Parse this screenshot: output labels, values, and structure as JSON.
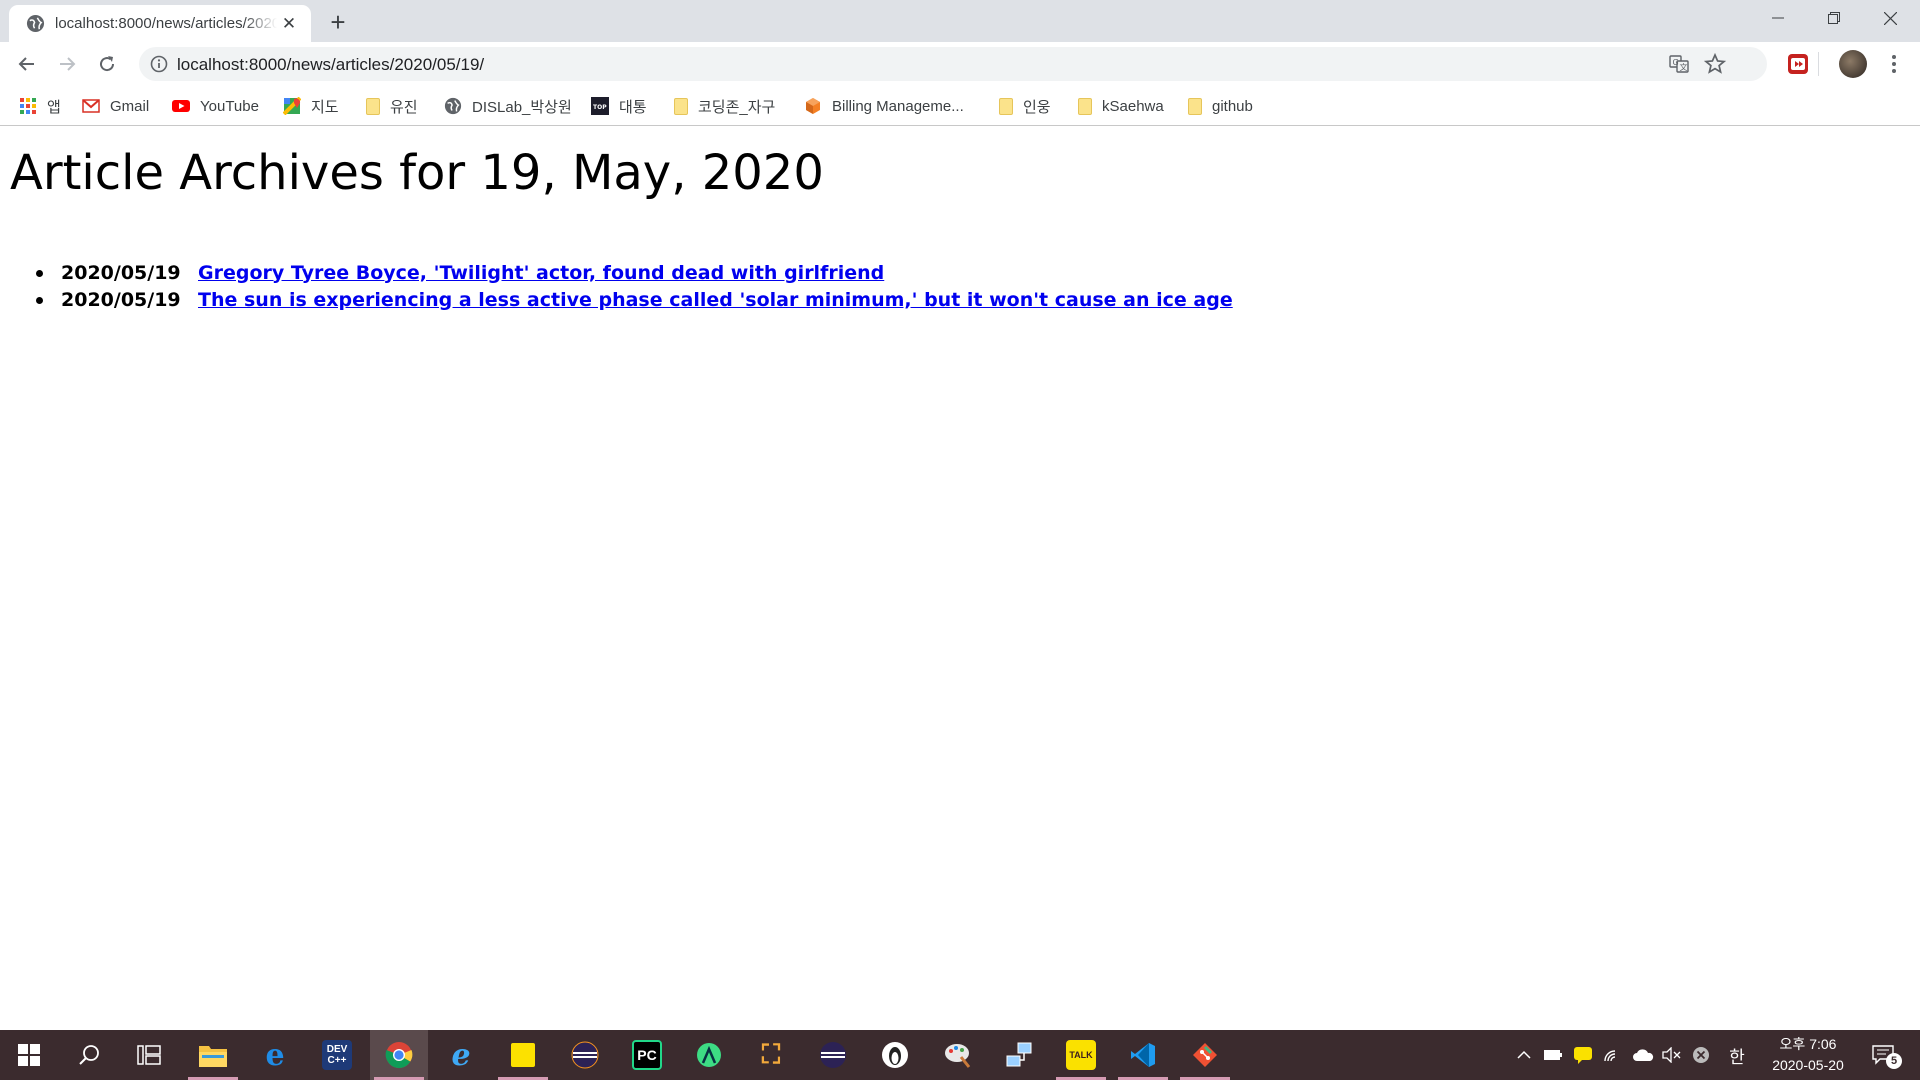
{
  "browser": {
    "tab": {
      "title": "localhost:8000/news/articles/2020/05/19/",
      "favicon": "globe-icon"
    },
    "url": "localhost:8000/news/articles/2020/05/19/"
  },
  "bookmarks": [
    {
      "label": "앱",
      "icon": "apps-grid-icon"
    },
    {
      "label": "Gmail",
      "icon": "gmail-icon"
    },
    {
      "label": "YouTube",
      "icon": "youtube-icon"
    },
    {
      "label": "지도",
      "icon": "maps-icon"
    },
    {
      "label": "유진",
      "icon": "folder-icon"
    },
    {
      "label": "DISLab_박상원",
      "icon": "globe-icon"
    },
    {
      "label": "대통",
      "icon": "site-icon"
    },
    {
      "label": "코딩존_자구",
      "icon": "folder-icon"
    },
    {
      "label": "Billing Manageme...",
      "icon": "aws-icon"
    },
    {
      "label": "인웅",
      "icon": "folder-icon"
    },
    {
      "label": "kSaehwa",
      "icon": "folder-icon"
    },
    {
      "label": "github",
      "icon": "folder-icon"
    }
  ],
  "page": {
    "heading": "Article Archives for 19, May, 2020",
    "articles": [
      {
        "date": "2020/05/19",
        "title": "Gregory Tyree Boyce, 'Twilight' actor, found dead with girlfriend"
      },
      {
        "date": "2020/05/19",
        "title": "The sun is experiencing a less active phase called 'solar minimum,' but it won't cause an ice age"
      }
    ]
  },
  "taskbar": {
    "clock": {
      "period_time": "오후 7:06",
      "date": "2020-05-20"
    },
    "ime": "한",
    "notification_count": "5"
  }
}
